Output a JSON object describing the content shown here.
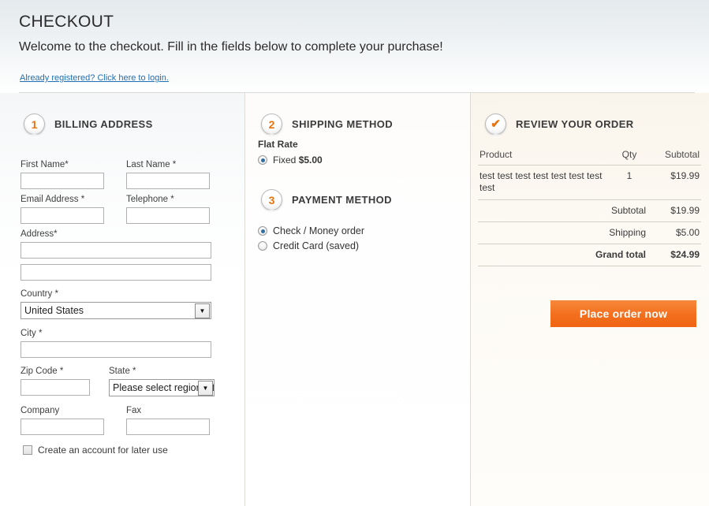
{
  "header": {
    "title": "CHECKOUT",
    "welcome": "Welcome to the checkout. Fill in the fields below to complete your purchase!",
    "login_link": "Already registered? Click here to login."
  },
  "billing": {
    "step_number": "1",
    "step_title": "BILLING ADDRESS",
    "fields": {
      "first_name": {
        "label": "First Name*",
        "value": "",
        "placeholder": ""
      },
      "last_name": {
        "label": "Last Name *",
        "value": "",
        "placeholder": ""
      },
      "email": {
        "label": "Email Address *",
        "value": "",
        "placeholder": ""
      },
      "telephone": {
        "label": "Telephone *",
        "value": "",
        "placeholder": ""
      },
      "address1": {
        "label": "Address*",
        "value": "",
        "placeholder": ""
      },
      "address2": {
        "label": "",
        "value": "",
        "placeholder": ""
      },
      "country": {
        "label": "Country *",
        "selected": "United States"
      },
      "city": {
        "label": "City *",
        "value": "",
        "placeholder": ""
      },
      "zip": {
        "label": "Zip Code *",
        "value": "",
        "placeholder": ""
      },
      "state": {
        "label": "State *",
        "selected": "Please select region, state or province."
      },
      "company": {
        "label": "Company",
        "value": "",
        "placeholder": ""
      },
      "fax": {
        "label": "Fax",
        "value": "",
        "placeholder": ""
      }
    },
    "create_account_label": "Create an account for later use",
    "create_account_checked": false,
    "dropdown_icon": "chevron-down-icon"
  },
  "shipping": {
    "step_number": "2",
    "step_title": "SHIPPING METHOD",
    "carrier": "Flat Rate",
    "options": [
      {
        "label": "Fixed",
        "price": "$5.00",
        "selected": true
      }
    ]
  },
  "payment": {
    "step_number": "3",
    "step_title": "PAYMENT METHOD",
    "options": [
      {
        "label": "Check / Money order",
        "selected": true
      },
      {
        "label": "Credit Card (saved)",
        "selected": false
      }
    ]
  },
  "review": {
    "step_icon": "check-icon",
    "step_title": "REVIEW YOUR ORDER",
    "columns": {
      "product": "Product",
      "qty": "Qty",
      "subtotal": "Subtotal"
    },
    "items": [
      {
        "name": "test test test test test test test test",
        "qty": "1",
        "subtotal": "$19.99"
      }
    ],
    "totals": [
      {
        "label": "Subtotal",
        "value": "$19.99",
        "grand": false
      },
      {
        "label": "Shipping",
        "value": "$5.00",
        "grand": false
      },
      {
        "label": "Grand total",
        "value": "$24.99",
        "grand": true
      }
    ],
    "place_order_label": "Place order now"
  },
  "colors": {
    "accent_orange": "#ef6412",
    "link_blue": "#1e6fb5",
    "radio_blue": "#2f6f9f"
  }
}
